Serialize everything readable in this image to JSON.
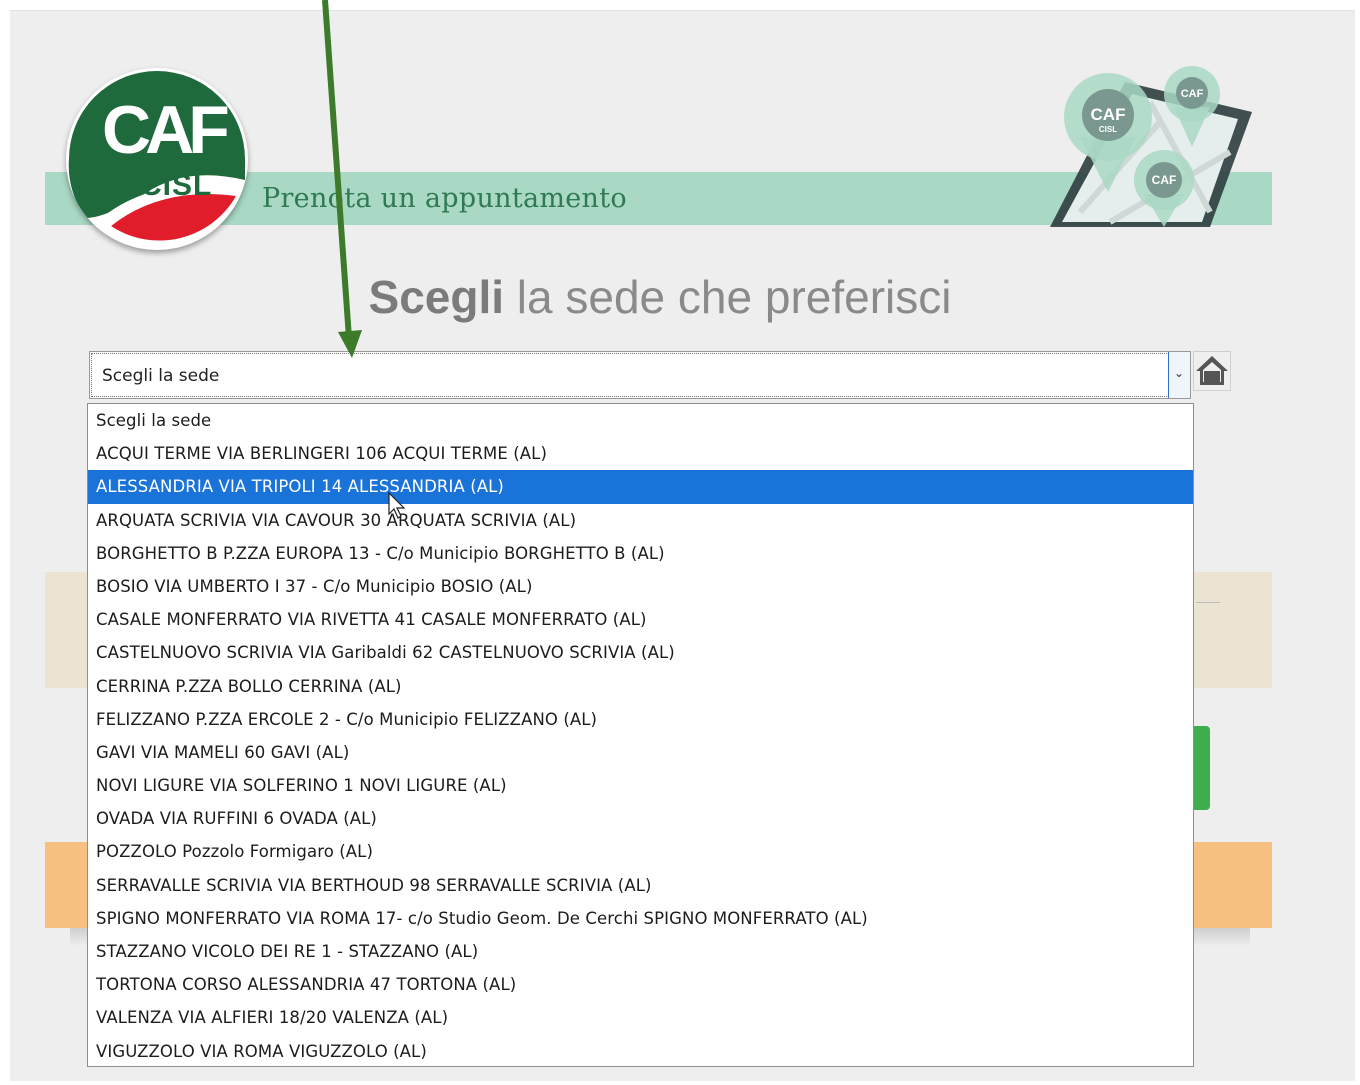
{
  "header": {
    "title": "Prenota un appuntamento",
    "logo_top": "CAF",
    "logo_bottom": "CISL",
    "pin_text": "CAF",
    "pin_subtext": "CISL"
  },
  "heading": {
    "bold": "Scegli",
    "rest": " la sede che preferisci"
  },
  "select": {
    "value": "Scegli la sede",
    "arrow_icon": "chevron-down-icon",
    "home_icon": "home-icon"
  },
  "dropdown": {
    "selected_index": 2,
    "options": [
      "Scegli la sede",
      "ACQUI TERME VIA BERLINGERI 106 ACQUI TERME (AL)",
      "ALESSANDRIA VIA TRIPOLI 14 ALESSANDRIA (AL)",
      "ARQUATA SCRIVIA VIA CAVOUR 30 ARQUATA SCRIVIA (AL)",
      "BORGHETTO B P.ZZA EUROPA 13 - C/o Municipio BORGHETTO B (AL)",
      "BOSIO VIA UMBERTO I 37 - C/o Municipio BOSIO (AL)",
      "CASALE MONFERRATO VIA RIVETTA 41 CASALE MONFERRATO (AL)",
      "CASTELNUOVO SCRIVIA VIA Garibaldi 62 CASTELNUOVO SCRIVIA (AL)",
      "CERRINA P.ZZA BOLLO CERRINA (AL)",
      "FELIZZANO P.ZZA ERCOLE 2 - C/o Municipio FELIZZANO (AL)",
      "GAVI VIA MAMELI 60 GAVI (AL)",
      "NOVI LIGURE VIA SOLFERINO 1 NOVI LIGURE (AL)",
      "OVADA VIA RUFFINI 6 OVADA (AL)",
      "POZZOLO Pozzolo Formigaro (AL)",
      "SERRAVALLE SCRIVIA VIA BERTHOUD 98 SERRAVALLE SCRIVIA (AL)",
      "SPIGNO MONFERRATO VIA ROMA 17- c/o Studio Geom. De Cerchi SPIGNO MONFERRATO (AL)",
      "STAZZANO VICOLO DEI RE 1 - STAZZANO (AL)",
      "TORTONA CORSO ALESSANDRIA 47 TORTONA (AL)",
      "VALENZA VIA ALFIERI 18/20 VALENZA (AL)",
      "VIGUZZOLO VIA ROMA VIGUZZOLO (AL)"
    ]
  },
  "colors": {
    "header_band": "#a9d8c4",
    "header_text": "#2f7a52",
    "logo_green": "#1f6a3c",
    "logo_red": "#e21d2b",
    "selected_option": "#1a73d8",
    "annotation_arrow": "#3d7a2a"
  }
}
